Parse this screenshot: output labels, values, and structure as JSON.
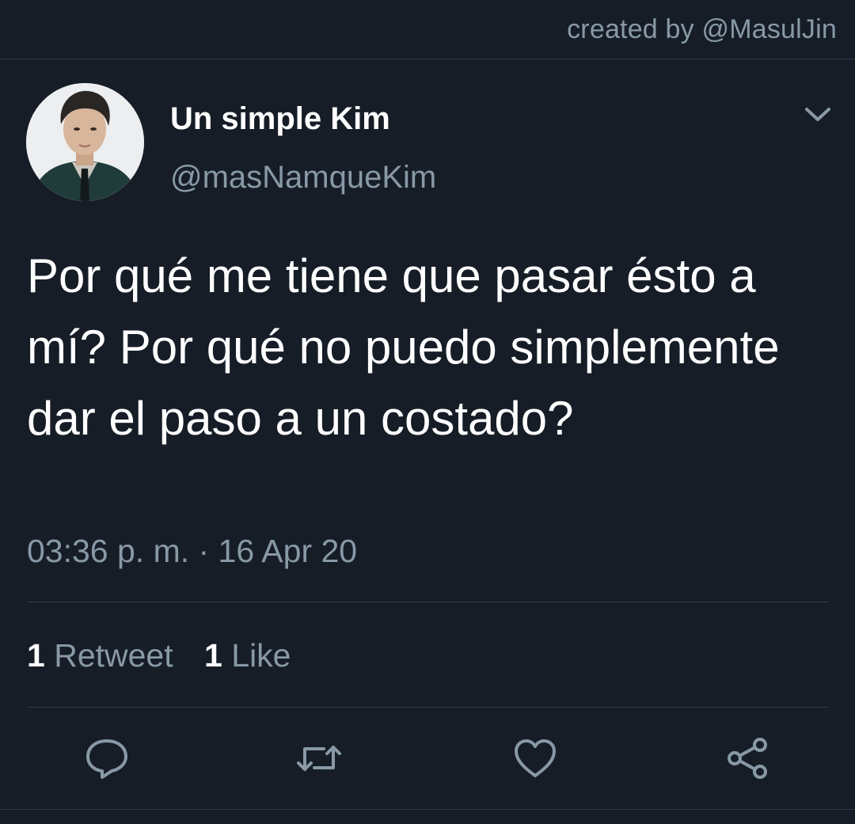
{
  "credit": "created by @MasulJin",
  "author": {
    "display_name": "Un simple Kim",
    "handle": "@masNamqueKim"
  },
  "tweet": {
    "text": "Por qué me tiene que pasar ésto a mí? Por qué no puedo simplemente dar el paso a un costado?",
    "timestamp": "03:36 p. m. · 16 Apr 20"
  },
  "stats": {
    "retweets": {
      "count": "1",
      "label": "Retweet"
    },
    "likes": {
      "count": "1",
      "label": "Like"
    }
  },
  "actions": [
    "reply-icon",
    "retweet-icon",
    "like-icon",
    "share-icon"
  ],
  "colors": {
    "background": "#161d27",
    "secondary_text": "#8899a6",
    "divider": "#2f3a46"
  }
}
